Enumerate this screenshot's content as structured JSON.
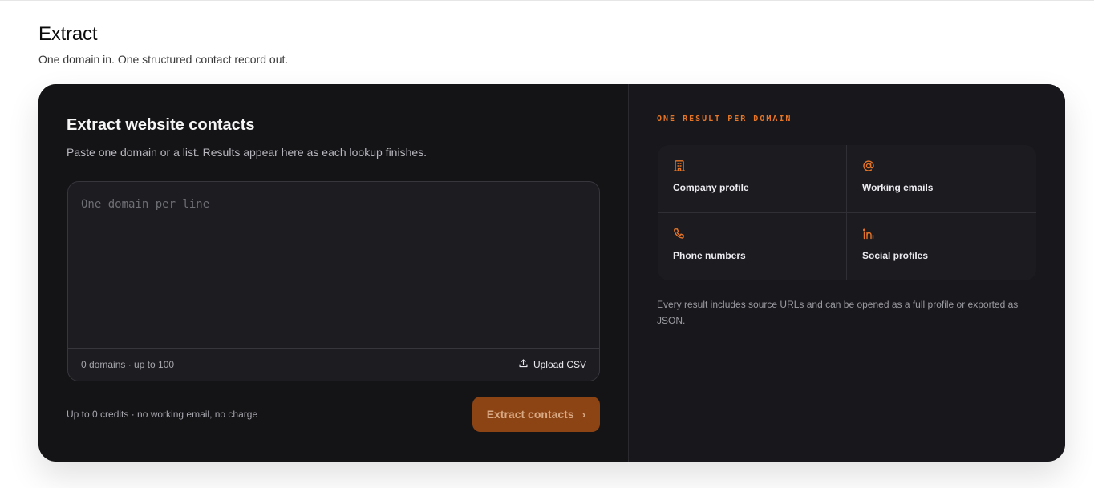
{
  "page": {
    "title": "Extract",
    "subtitle": "One domain in. One structured contact record out."
  },
  "extract_panel": {
    "title": "Extract website contacts",
    "description": "Paste one domain or a list. Results appear here as each lookup finishes.",
    "input_placeholder": "One domain per line",
    "input_value": "",
    "domain_count": "0 domains · up to 100",
    "upload_label": "Upload CSV",
    "credits_note": "Up to 0 credits · no working email, no charge",
    "submit_label": "Extract contacts"
  },
  "info_panel": {
    "kicker": "ONE RESULT PER DOMAIN",
    "features": [
      {
        "label": "Company profile",
        "icon": "building-icon"
      },
      {
        "label": "Working emails",
        "icon": "at-sign-icon"
      },
      {
        "label": "Phone numbers",
        "icon": "phone-icon"
      },
      {
        "label": "Social profiles",
        "icon": "linkedin-icon"
      }
    ],
    "note": "Every result includes source URLs and can be opened as a full profile or exported as JSON."
  },
  "colors": {
    "accent": "#e67528",
    "button_bg": "#8c4415",
    "card_bg": "#141417"
  }
}
